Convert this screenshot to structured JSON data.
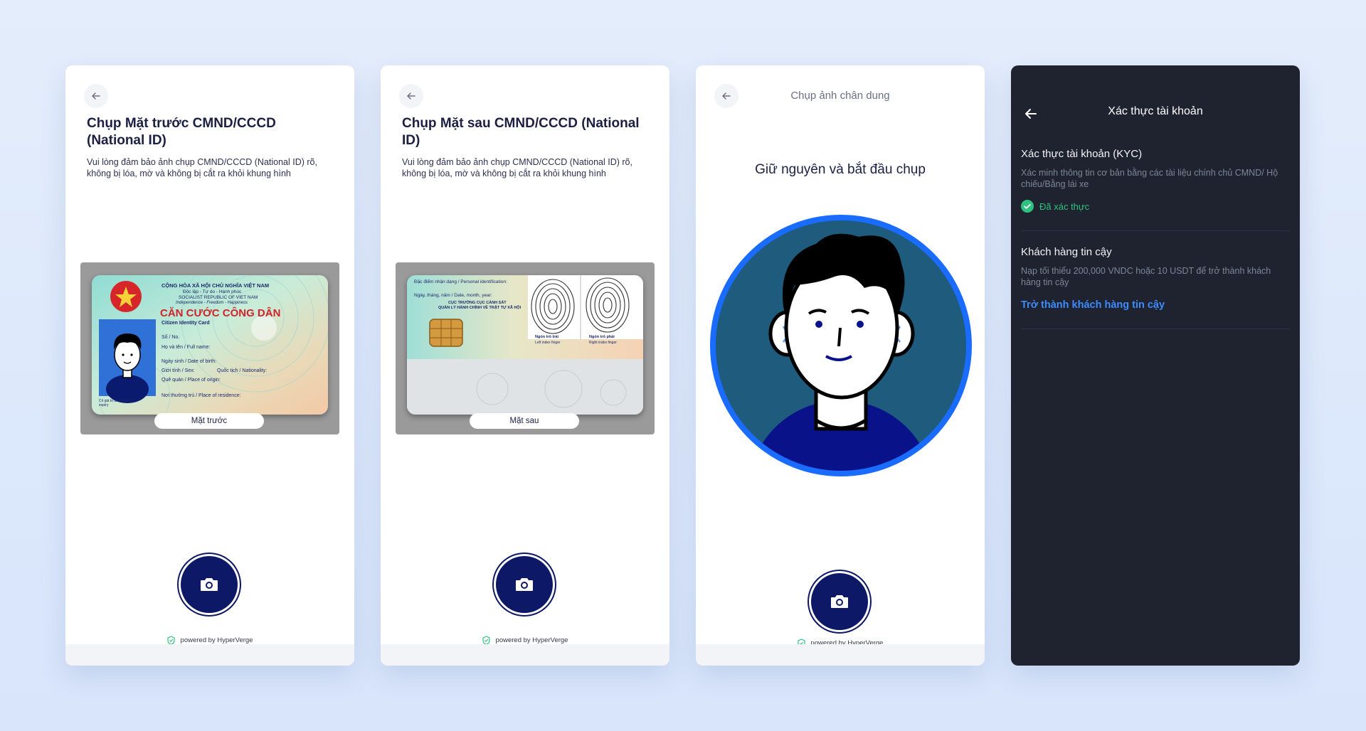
{
  "screen1": {
    "title": "Chụp Mặt trước CMND/CCCD (National ID)",
    "description": "Vui lòng đảm bảo ảnh chụp CMND/CCCD (National ID) rõ, không bị lóa, mờ và không bị cắt ra khỏi khung hình",
    "card": {
      "country_header": "CỘNG HÒA XÃ HỘI CHỦ NGHĨA VIỆT NAM",
      "motto": "Độc lập - Tự do - Hạnh phúc",
      "country_en": "SOCIALIST REPUBLIC OF VIET NAM",
      "motto_en": "Independence - Freedom - Happiness",
      "card_title": "CĂN CƯỚC CÔNG DÂN",
      "card_title_en": "Citizen Identity Card",
      "field_no": "Số / No.",
      "field_name": "Họ và tên / Full name:",
      "field_dob": "Ngày sinh / Date of birth:",
      "field_sex": "Giới tính / Sex:",
      "field_nationality": "Quốc tịch / Nationality:",
      "field_origin": "Quê quán / Place of origin:",
      "field_residence": "Nơi thường trú / Place of residence:",
      "field_expiry": "Có giá trị đến: Date of expiry"
    },
    "card_label": "Mặt trước",
    "powered_by": "powered by HyperVerge"
  },
  "screen2": {
    "title": "Chụp Mặt sau CMND/CCCD (National ID)",
    "description": "Vui lòng đảm bảo ảnh chụp CMND/CCCD (National ID) rõ, không bị lóa, mờ và không bị cắt ra khỏi khung hình",
    "card": {
      "field_identification": "Đặc điểm nhận dạng / Personal identification:",
      "field_date": "Ngày, tháng, năm / Date, month, year:",
      "authority_1": "CỤC TRƯỞNG CỤC CẢNH SÁT",
      "authority_2": "QUẢN LÝ HÀNH CHÍNH VỀ TRẬT TỰ XÃ HỘI",
      "left_finger": "Ngón trỏ trái",
      "left_finger_en": "Left index finger",
      "right_finger": "Ngón trỏ phải",
      "right_finger_en": "Right index finger"
    },
    "card_label": "Mặt sau",
    "powered_by": "powered by HyperVerge"
  },
  "screen3": {
    "header": "Chụp ảnh chân dung",
    "instruction": "Giữ nguyên và bắt đầu chụp",
    "powered_by": "powered by HyperVerge"
  },
  "screen4": {
    "header": "Xác thực tài khoản",
    "kyc": {
      "title": "Xác thực tài khoản (KYC)",
      "description": "Xác minh thông tin cơ bản bằng các tài liệu chính chủ CMND/ Hộ chiếu/Bằng lái xe",
      "status": "Đã xác thực"
    },
    "trusted": {
      "title": "Khách hàng tin cậy",
      "description": "Nạp tối thiểu 200,000 VNDC hoặc 10 USDT để trở thành khách hàng tin cậy",
      "action": "Trở thành khách hàng tin cậy"
    }
  },
  "colors": {
    "primary_dark": "#0d1866",
    "accent_blue": "#1a6bff",
    "verified_green": "#2ec27e",
    "link_blue": "#3d8bff",
    "dark_panel": "#1f2330"
  }
}
